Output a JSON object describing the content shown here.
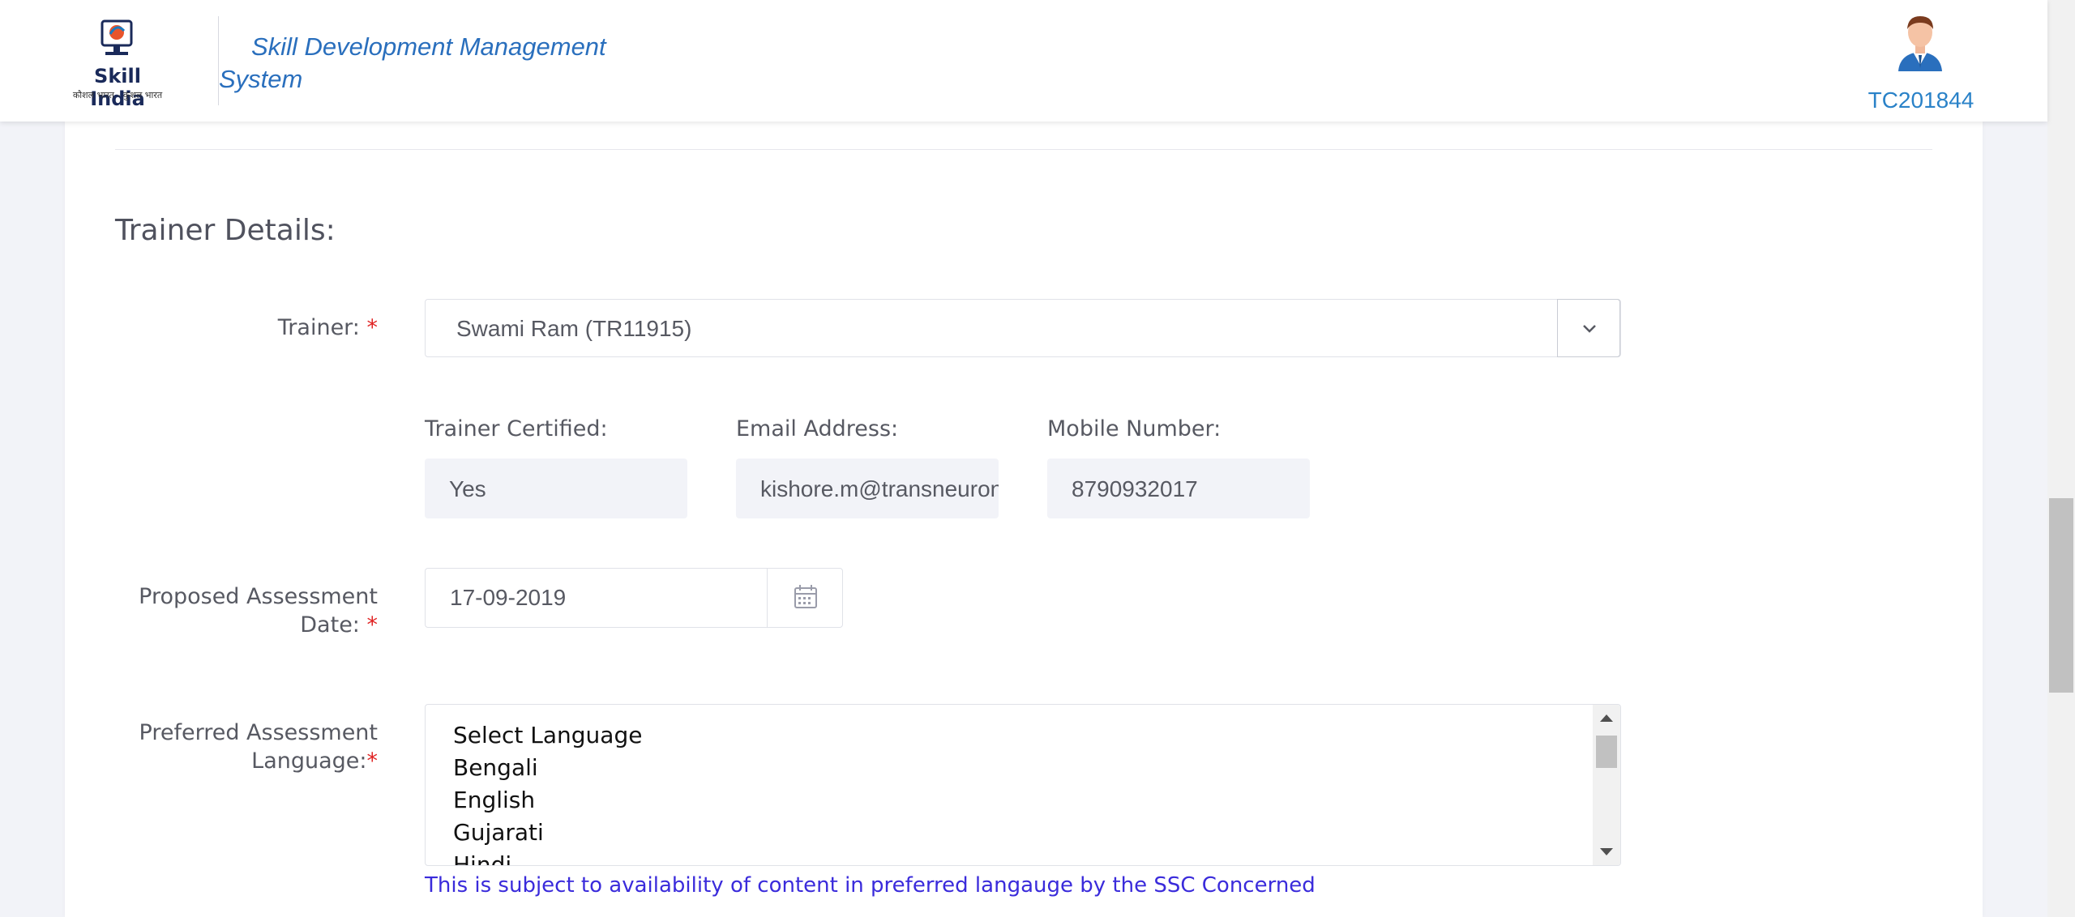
{
  "header": {
    "logo_text": "Skill India",
    "logo_tagline": "कौशल भारत - कुशल भारत",
    "app_title_line1": "Skill Development Management",
    "app_title_line2": "System",
    "user_id": "TC201844"
  },
  "trainer_section": {
    "title": "Trainer Details:",
    "trainer_label": "Trainer:",
    "trainer_value": "Swami Ram (TR11915)",
    "certified_label": "Trainer Certified:",
    "certified_value": "Yes",
    "email_label": "Email Address:",
    "email_value": "kishore.m@transneuron.com",
    "mobile_label": "Mobile Number:",
    "mobile_value": "8790932017",
    "date_label_line1": "Proposed Assessment",
    "date_label_line2": "Date:",
    "date_value": "17-09-2019",
    "language_label_line1": "Preferred Assessment",
    "language_label_line2": "Language:",
    "language_options": [
      "Select Language",
      "Bengali",
      "English",
      "Gujarati",
      "Hindi"
    ],
    "language_hint": "This is subject to availability of content in preferred langauge by the SSC Concerned",
    "required_mark": "*"
  },
  "colors": {
    "accent_blue": "#2a6fbd",
    "required_red": "#e02424",
    "hint_blue": "#3a2bdb"
  }
}
